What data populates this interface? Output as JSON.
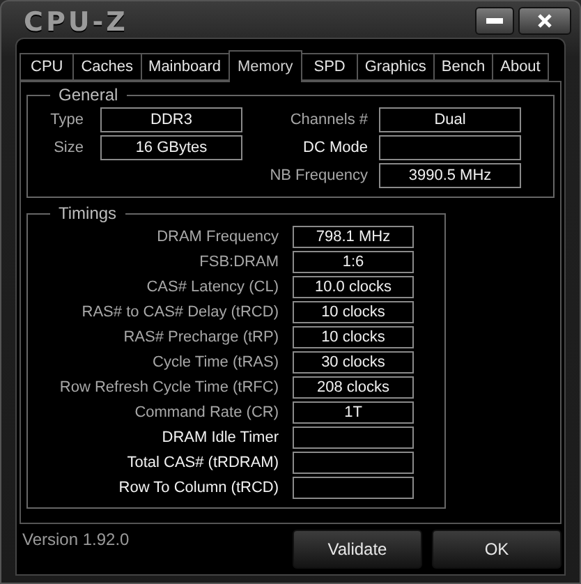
{
  "window": {
    "title": "CPU-Z"
  },
  "tabs": [
    {
      "label": "CPU",
      "selected": false
    },
    {
      "label": "Caches",
      "selected": false
    },
    {
      "label": "Mainboard",
      "selected": false
    },
    {
      "label": "Memory",
      "selected": true
    },
    {
      "label": "SPD",
      "selected": false
    },
    {
      "label": "Graphics",
      "selected": false
    },
    {
      "label": "Bench",
      "selected": false
    },
    {
      "label": "About",
      "selected": false
    }
  ],
  "general": {
    "title": "General",
    "left_fields": [
      {
        "label": "Type",
        "value": "DDR3",
        "emphasized": false
      },
      {
        "label": "Size",
        "value": "16 GBytes",
        "emphasized": false
      }
    ],
    "right_fields": [
      {
        "label": "Channels #",
        "value": "Dual",
        "emphasized": false
      },
      {
        "label": "DC Mode",
        "emphasized": true
      },
      {
        "label": "NB Frequency",
        "value": "3990.5 MHz",
        "emphasized": false
      }
    ]
  },
  "timings": {
    "title": "Timings",
    "fields": [
      {
        "label": "DRAM Frequency",
        "value": "798.1 MHz",
        "emphasized": false
      },
      {
        "label": "FSB:DRAM",
        "value": "1:6",
        "emphasized": false
      },
      {
        "label": "CAS# Latency (CL)",
        "value": "10.0 clocks",
        "emphasized": false
      },
      {
        "label": "RAS# to CAS# Delay (tRCD)",
        "value": "10 clocks",
        "emphasized": false
      },
      {
        "label": "RAS# Precharge (tRP)",
        "value": "10 clocks",
        "emphasized": false
      },
      {
        "label": "Cycle Time (tRAS)",
        "value": "30 clocks",
        "emphasized": false
      },
      {
        "label": "Row Refresh Cycle Time (tRFC)",
        "value": "208 clocks",
        "emphasized": false
      },
      {
        "label": "Command Rate (CR)",
        "value": "1T",
        "emphasized": false
      },
      {
        "label": "DRAM Idle Timer",
        "emphasized": true
      },
      {
        "label": "Total CAS# (tRDRAM)",
        "emphasized": true
      },
      {
        "label": "Row To Column (tRCD)",
        "emphasized": true
      }
    ]
  },
  "status_bar": {
    "version": "Version 1.92.0"
  },
  "buttons": [
    "Validate",
    "OK"
  ]
}
